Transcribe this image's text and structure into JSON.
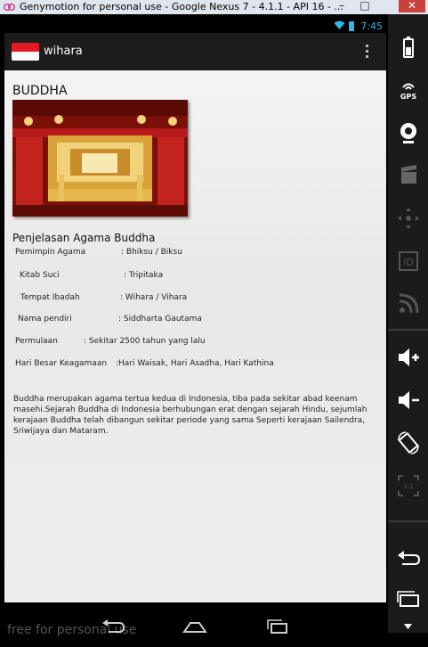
{
  "window": {
    "title": "Genymotion for personal use - Google Nexus 7 - 4.1.1 - API 16 - ...",
    "minimize_label": "–",
    "maximize_label": "□",
    "close_label": "✕"
  },
  "status_bar": {
    "time": "7:45"
  },
  "action_bar": {
    "title": "wihara"
  },
  "content": {
    "heading": "BUDDHA",
    "section_title": "Penjelasan Agama Buddha",
    "info_rows": [
      {
        "label": "Pemimpin Agama",
        "value": ": Bhiksu / Biksu"
      },
      {
        "label": "Kitab Suci",
        "value": ": Tripitaka"
      },
      {
        "label": "Tempat Ibadah",
        "value": ": Wihara / Vihara"
      },
      {
        "label": "Nama pendiri",
        "value": ": Siddharta Gautama"
      },
      {
        "label": "Permulaan",
        "value": ": Sekitar 2500 tahun yang lalu"
      },
      {
        "label": "Hari Besar Keagamaan",
        "value": ":Hari Waisak, Hari Asadha, Hari Kathina"
      }
    ],
    "description": "Buddha  merupakan agama tertua kedua di Indonesia, tiba pada sekitar abad keenam masehi.Sejarah Buddha di Indonesia berhubungan erat dengan sejarah Hindu, sejumlah kerajaan Buddha telah dibangun sekitar periode yang sama Seperti kerajaan Sailendra, Sriwijaya dan Mataram."
  },
  "navigation": {
    "watermark": "free for personal use"
  },
  "colors": {
    "accent": "#33b5e5",
    "flag_red": "#e01b24",
    "flag_white": "#fafafa"
  }
}
